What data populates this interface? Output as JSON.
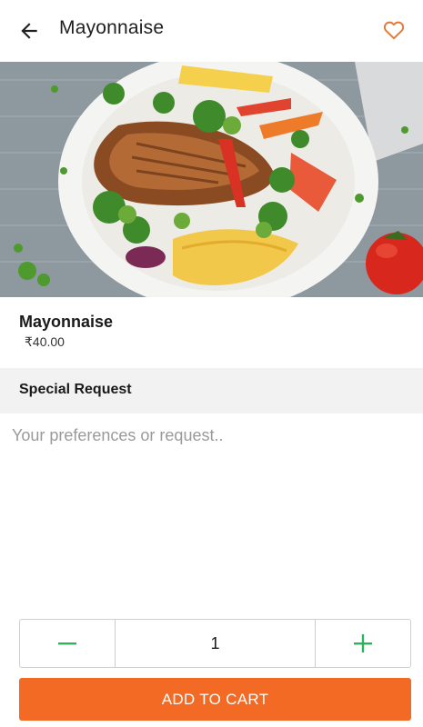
{
  "header": {
    "back_icon": "arrow-left-icon",
    "title": "Mayonnaise",
    "favorite_icon": "heart-outline-icon"
  },
  "hero": {
    "image": "plate of grilled chicken with salad, mango slices and tomatoes"
  },
  "item": {
    "name": "Mayonnaise",
    "price": "₹40.00"
  },
  "special_request": {
    "title": "Special Request",
    "placeholder": "Your preferences or request..",
    "value": ""
  },
  "quantity": {
    "decrement_icon": "minus-icon",
    "value": "1",
    "increment_icon": "plus-icon"
  },
  "cart": {
    "button_label": "ADD TO CART"
  },
  "colors": {
    "accent": "#f26a24",
    "stepper_icon": "#2bb35e",
    "heart": "#e07b39",
    "section_bg": "#f2f2f2"
  }
}
